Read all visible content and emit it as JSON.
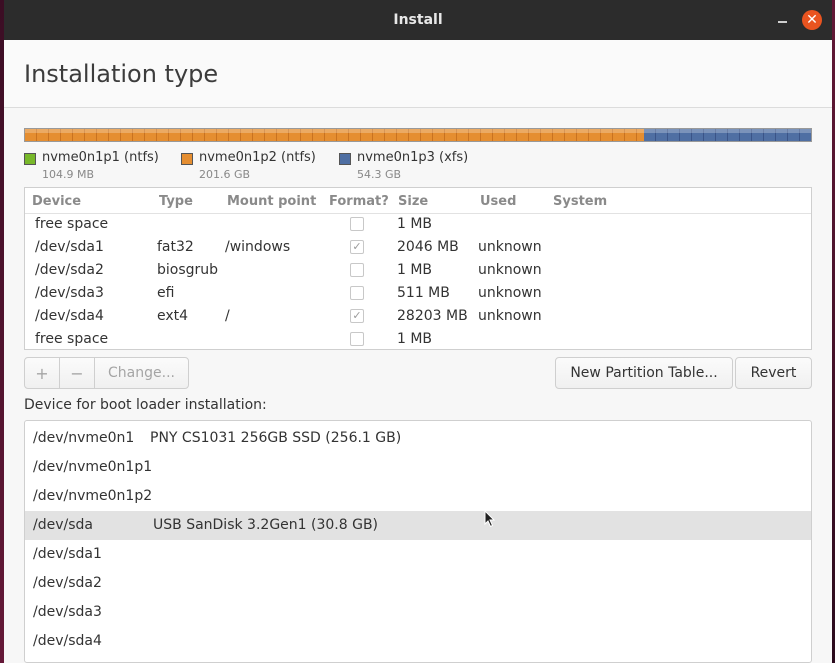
{
  "window": {
    "title": "Install"
  },
  "header": {
    "title": "Installation type"
  },
  "partition_bar": {
    "segments": [
      {
        "name": "nvme0n1p1 (ntfs)",
        "size": "104.9 MB",
        "color": "#78b82a",
        "fraction": 0.0003
      },
      {
        "name": "nvme0n1p2 (ntfs)",
        "size": "201.6 GB",
        "color": "#e58e31",
        "fraction": 0.787
      },
      {
        "name": "nvme0n1p3 (xfs)",
        "size": "54.3 GB",
        "color": "#4f6fa3",
        "fraction": 0.2127
      }
    ]
  },
  "partition_table": {
    "headers": [
      "Device",
      "Type",
      "Mount point",
      "Format?",
      "Size",
      "Used",
      "System"
    ],
    "rows": [
      {
        "device": "free space",
        "type": "",
        "mount": "",
        "format": false,
        "size": "1 MB",
        "used": "",
        "system": ""
      },
      {
        "device": "/dev/sda1",
        "type": "fat32",
        "mount": "/windows",
        "format": true,
        "size": "2046 MB",
        "used": "unknown",
        "system": ""
      },
      {
        "device": "/dev/sda2",
        "type": "biosgrub",
        "mount": "",
        "format": false,
        "size": "1 MB",
        "used": "unknown",
        "system": ""
      },
      {
        "device": "/dev/sda3",
        "type": "efi",
        "mount": "",
        "format": false,
        "size": "511 MB",
        "used": "unknown",
        "system": ""
      },
      {
        "device": "/dev/sda4",
        "type": "ext4",
        "mount": "/",
        "format": true,
        "size": "28203 MB",
        "used": "unknown",
        "system": ""
      },
      {
        "device": "free space",
        "type": "",
        "mount": "",
        "format": false,
        "size": "1 MB",
        "used": "",
        "system": ""
      }
    ]
  },
  "toolbar": {
    "add_label": "+",
    "remove_label": "−",
    "change_label": "Change...",
    "new_table_label": "New Partition Table...",
    "revert_label": "Revert"
  },
  "bootloader": {
    "label": "Device for boot loader installation:",
    "items": [
      {
        "device": "/dev/nvme0n1",
        "desc": "PNY CS1031 256GB SSD (256.1 GB)"
      },
      {
        "device": "/dev/nvme0n1p1",
        "desc": ""
      },
      {
        "device": "/dev/nvme0n1p2",
        "desc": ""
      },
      {
        "device": "/dev/sda",
        "desc": "USB  SanDisk 3.2Gen1 (30.8 GB)"
      },
      {
        "device": "/dev/sda1",
        "desc": ""
      },
      {
        "device": "/dev/sda2",
        "desc": ""
      },
      {
        "device": "/dev/sda3",
        "desc": ""
      },
      {
        "device": "/dev/sda4",
        "desc": ""
      }
    ],
    "selected_index": 3
  }
}
